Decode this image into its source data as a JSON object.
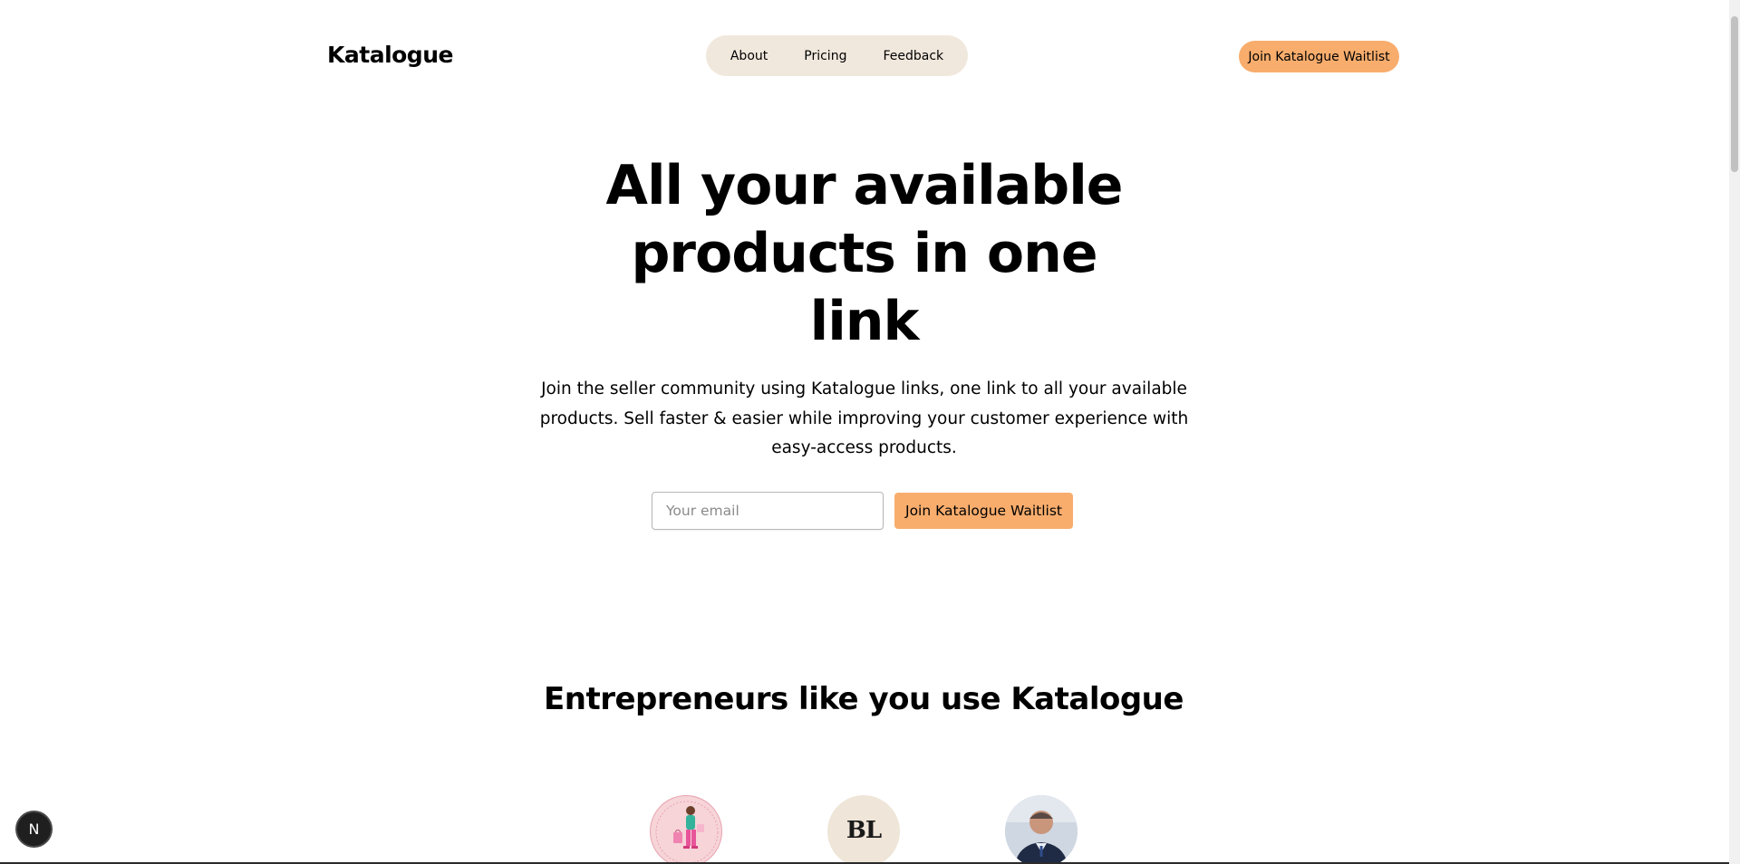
{
  "header": {
    "brand": "Katalogue",
    "nav": [
      {
        "label": "About"
      },
      {
        "label": "Pricing"
      },
      {
        "label": "Feedback"
      }
    ],
    "cta_label": "Join Katalogue Waitlist"
  },
  "hero": {
    "title": "All your available products in one link",
    "subtitle": "Join the seller community using Katalogue links, one link to all your available products. Sell faster & easier while improving your customer experience with easy-access products.",
    "email_placeholder": "Your email",
    "cta_label": "Join Katalogue Waitlist"
  },
  "section": {
    "title": "Entrepreneurs like you use Katalogue"
  },
  "avatars": [
    {
      "icon": "shopper-illustration-avatar"
    },
    {
      "icon": "bl-logo-avatar",
      "mark": "BL"
    },
    {
      "icon": "person-photo-avatar"
    }
  ],
  "dev_badge": {
    "glyph": "N",
    "icon": "nextjs-icon"
  },
  "colors": {
    "accent": "#f8ad6d",
    "nav_bg": "#f1e8dd"
  }
}
